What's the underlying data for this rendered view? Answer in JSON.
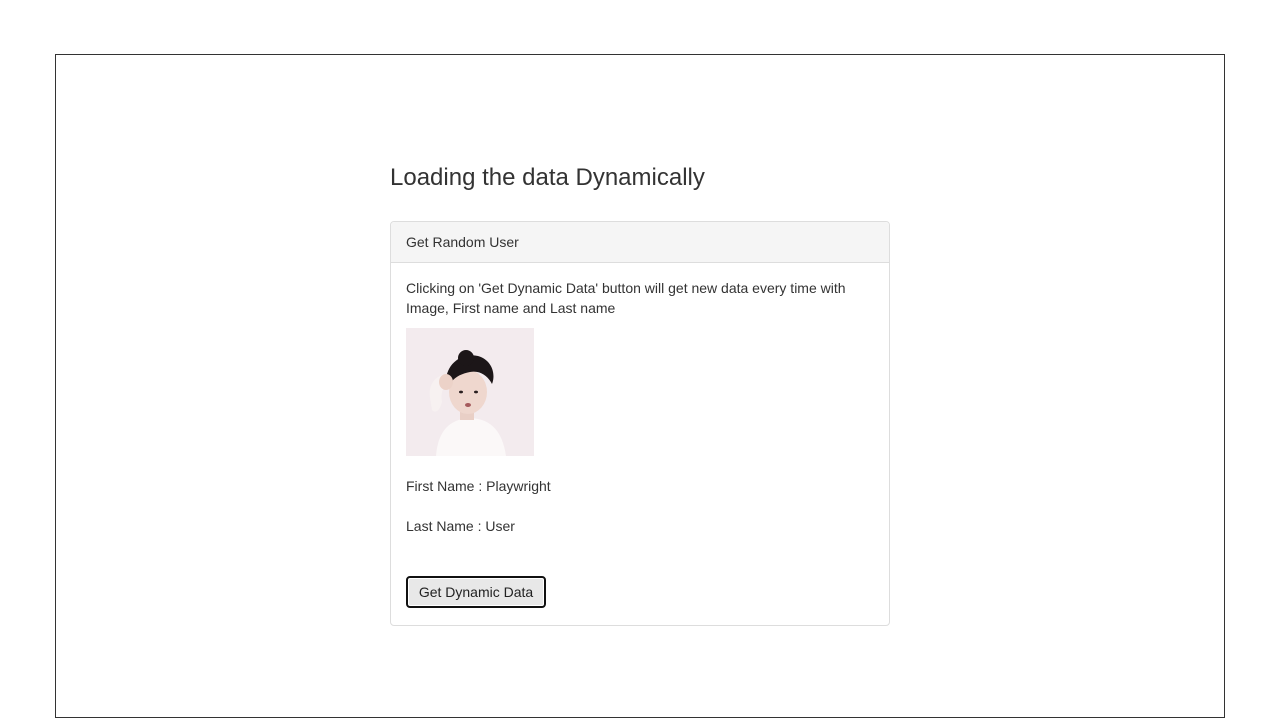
{
  "page": {
    "title": "Loading the data Dynamically"
  },
  "card": {
    "header": "Get Random User",
    "description": "Clicking on 'Get Dynamic Data' button will get new data every time with Image, First name and Last name",
    "first_name_label": "First Name : Playwright",
    "last_name_label": "Last Name : User",
    "button_label": "Get Dynamic Data"
  },
  "colors": {
    "text": "#333333",
    "header_bg": "#f5f5f5",
    "border": "#dddddd",
    "button_bg": "#e8e8e8"
  }
}
